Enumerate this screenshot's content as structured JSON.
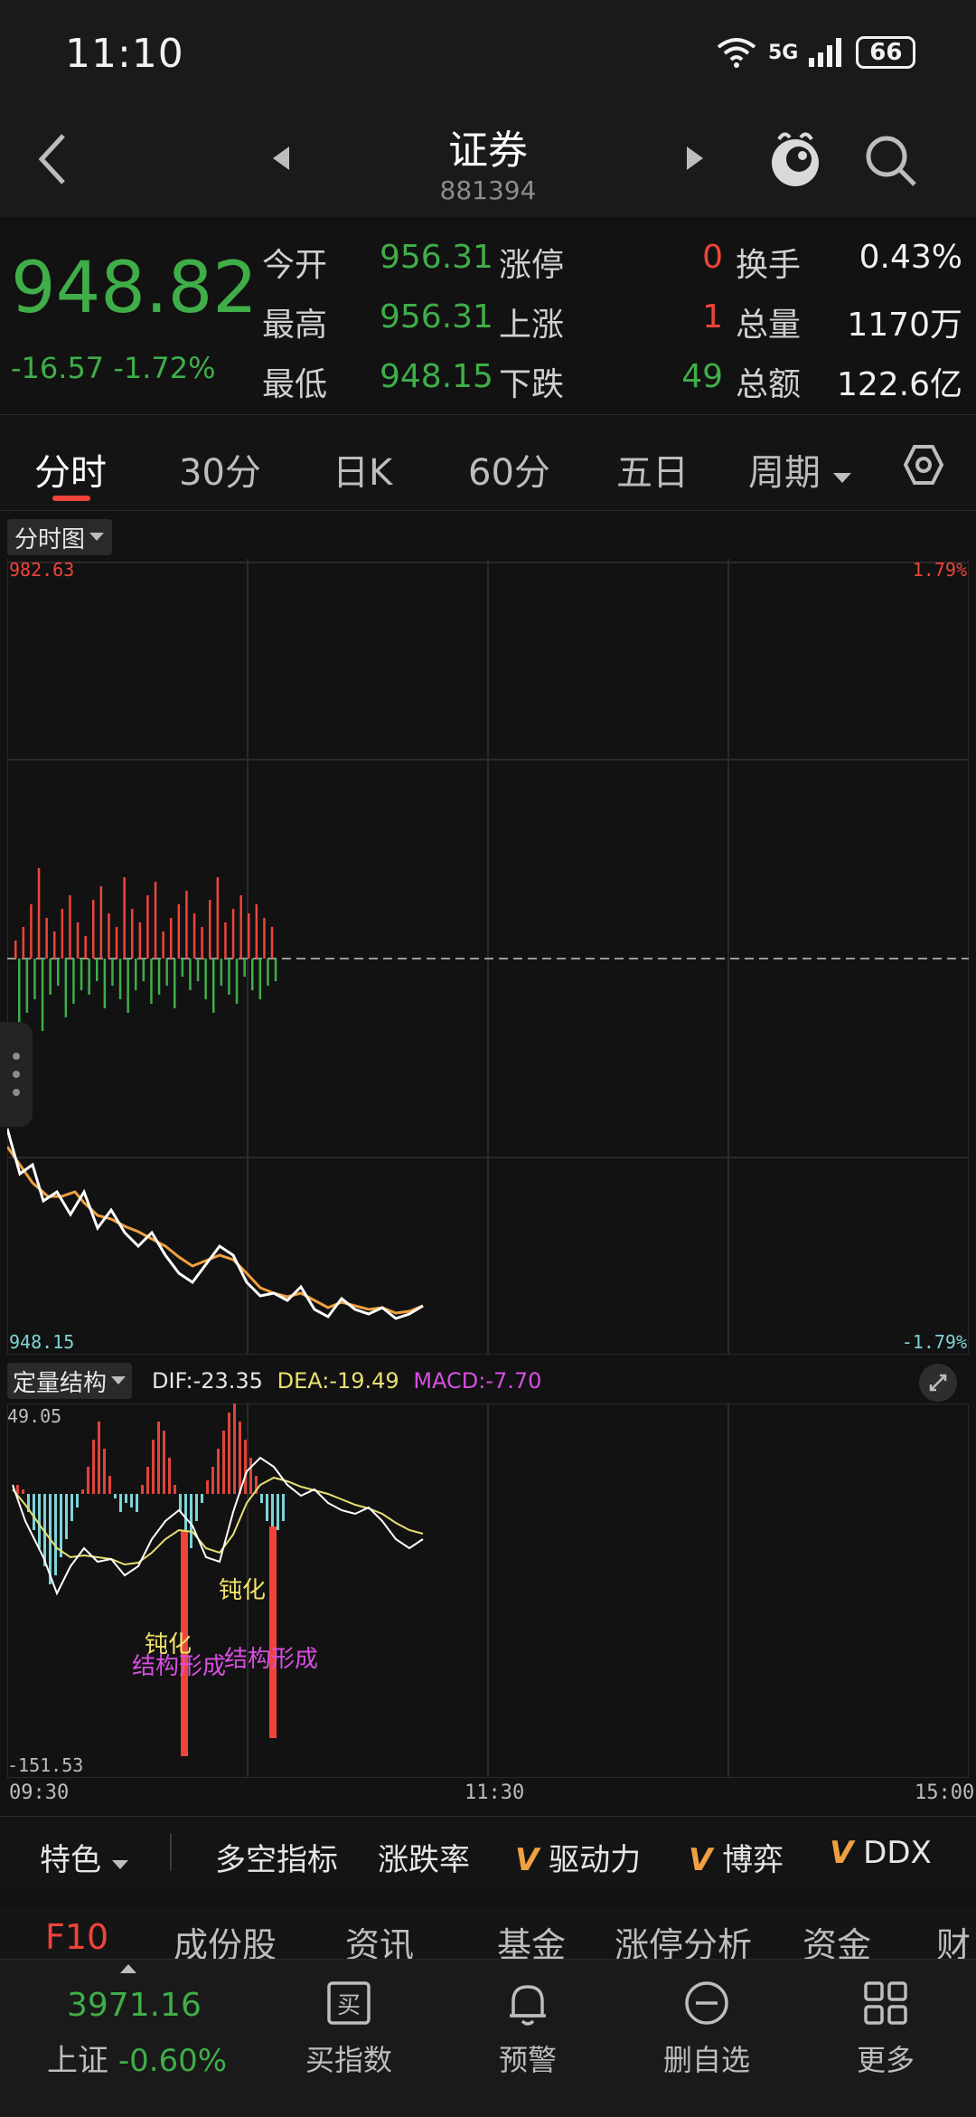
{
  "status_bar": {
    "time": "11:10",
    "network": "5G",
    "battery": "66",
    "wifi_icon": "wifi-icon",
    "signal_icon": "signal-icon"
  },
  "header": {
    "title": "证券",
    "code": "881394",
    "back_icon": "back-icon",
    "prev_icon": "prev-triangle-icon",
    "next_icon": "next-triangle-icon",
    "mascot_icon": "mascot-icon",
    "search_icon": "search-icon"
  },
  "quote": {
    "price": "948.82",
    "change": "-16.57",
    "change_pct": "-1.72%",
    "rows": [
      {
        "l1": "今开",
        "v1": "956.31",
        "l2": "涨停",
        "v2": "0",
        "l3": "换手",
        "v3": "0.43%"
      },
      {
        "l1": "最高",
        "v1": "956.31",
        "l2": "上涨",
        "v2": "1",
        "l3": "总量",
        "v3": "1170万"
      },
      {
        "l1": "最低",
        "v1": "948.15",
        "l2": "下跌",
        "v2": "49",
        "l3": "总额",
        "v3": "122.6亿"
      }
    ]
  },
  "tabs": [
    "分时",
    "30分",
    "日K",
    "60分",
    "五日",
    "周期"
  ],
  "tabs_settings_icon": "hexagon-settings-icon",
  "chart_selector": "分时图",
  "chart_labels": {
    "top_price": "982.63",
    "top_pct": "1.79%",
    "bottom_price": "948.15",
    "bottom_pct": "-1.79%"
  },
  "macd": {
    "selector": "定量结构",
    "dif": "DIF:-23.35",
    "dea": "DEA:-19.49",
    "macd": "MACD:-7.70",
    "top": "49.05",
    "bottom": "-151.53",
    "ann1": "钝化",
    "ann2": "钝化",
    "ann3": "结构形成",
    "ann4": "结构形成",
    "expand_icon": "expand-icon"
  },
  "time_axis": [
    "09:30",
    "11:30",
    "15:00"
  ],
  "indicator_bar": {
    "feature": "特色",
    "items": [
      "多空指标",
      "涨跌率",
      "驱动力",
      "博弈",
      "DDX"
    ]
  },
  "f10_tabs": [
    "F10",
    "成份股",
    "资讯",
    "基金",
    "涨停分析",
    "资金",
    "财"
  ],
  "bottom_nav": {
    "index_value": "3971.16",
    "index_name": "上证",
    "index_pct": "-0.60%",
    "items": [
      {
        "label": "买指数",
        "icon": "buy-index-icon"
      },
      {
        "label": "预警",
        "icon": "bell-icon"
      },
      {
        "label": "删自选",
        "icon": "remove-circle-icon"
      },
      {
        "label": "更多",
        "icon": "grid-more-icon"
      }
    ]
  },
  "colors": {
    "up": "#f0443a",
    "down": "#3fae49",
    "price_line": "#ffffff",
    "avg_line": "#f0a040",
    "dea_line": "#e8e070",
    "macd_pos": "#e0443a",
    "macd_neg": "#7dd3d8",
    "magenta": "#d84ee0"
  },
  "chart_data": {
    "type": "line",
    "x_range": [
      "09:30",
      "15:00"
    ],
    "ylim": [
      948.15,
      982.63
    ],
    "intraday_volume_bars": "red/green bars around 0 baseline",
    "macd_range": [
      -151.53,
      49.05
    ]
  }
}
